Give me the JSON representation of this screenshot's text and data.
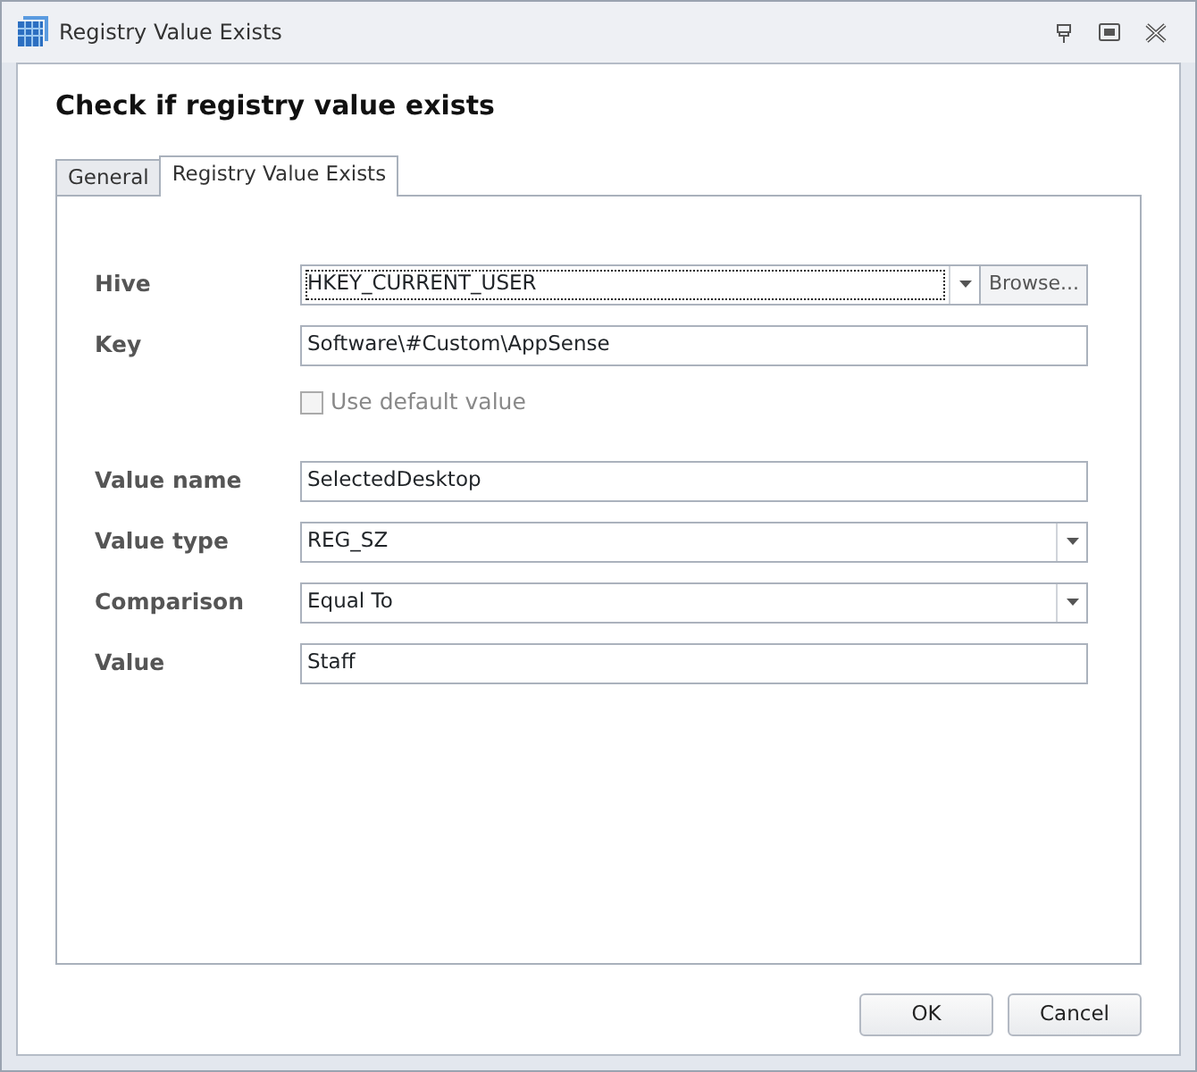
{
  "window": {
    "title": "Registry Value Exists"
  },
  "heading": "Check if registry value exists",
  "tabs": [
    {
      "label": "General",
      "selected": false
    },
    {
      "label": "Registry Value Exists",
      "selected": true
    }
  ],
  "fields": [
    {
      "kind": "combo_browse",
      "label": "Hive",
      "value": "HKEY_CURRENT_USER",
      "focused": true,
      "browse": "Browse..."
    },
    {
      "kind": "text",
      "label": "Key",
      "value": "Software\\#Custom\\AppSense"
    },
    {
      "kind": "checkbox",
      "label": "Use default value",
      "checked": false,
      "disabled": true
    },
    {
      "kind": "text",
      "label": "Value name",
      "value": "SelectedDesktop"
    },
    {
      "kind": "combo",
      "label": "Value type",
      "value": "REG_SZ"
    },
    {
      "kind": "combo",
      "label": "Comparison",
      "value": "Equal To"
    },
    {
      "kind": "text",
      "label": "Value",
      "value": "Staff"
    }
  ],
  "buttons": [
    "OK",
    "Cancel"
  ]
}
